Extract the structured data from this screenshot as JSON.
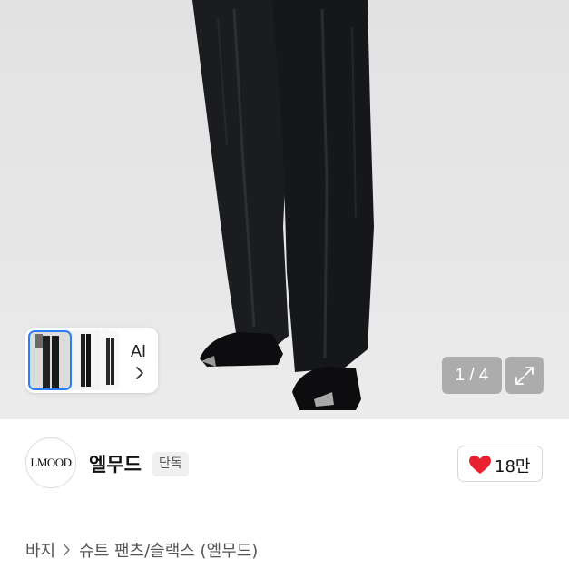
{
  "gallery": {
    "counter": "1 / 4",
    "ai_label": "AI",
    "icons": {
      "expand": "expand-icon",
      "chevron": "chevron-right-icon"
    }
  },
  "brand": {
    "logo_text": "LMOOD",
    "name": "엘무드",
    "badge": "단독"
  },
  "like": {
    "count": "18만",
    "icon": "heart-icon",
    "color": "#e8202f"
  },
  "breadcrumb": {
    "category": "바지",
    "subcategory": "슈트 팬츠/슬랙스 (엘무드)"
  }
}
